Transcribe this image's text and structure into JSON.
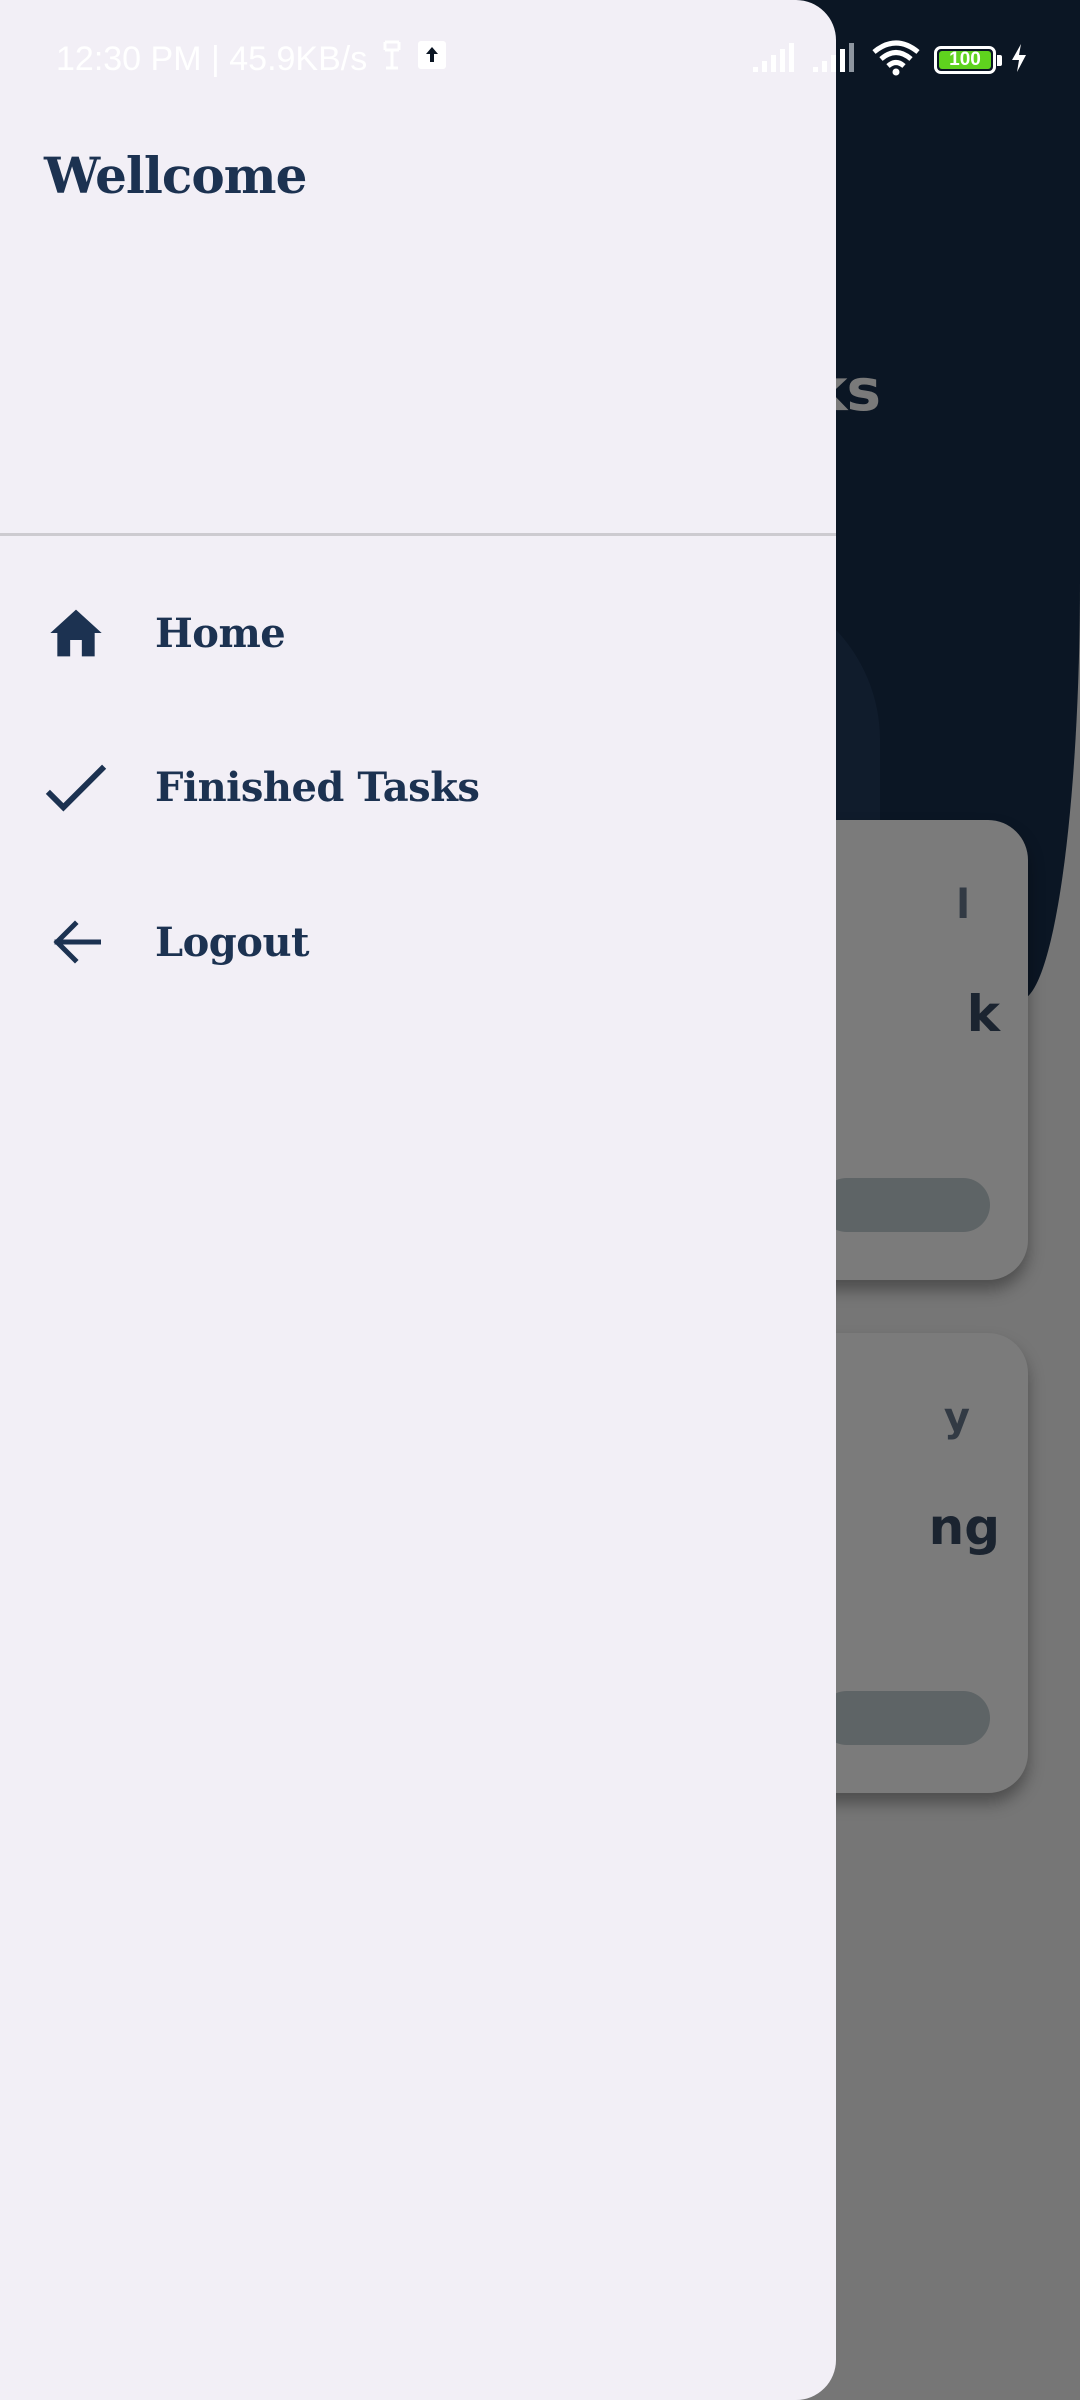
{
  "status_bar": {
    "time_speed": "12:30 PM | 45.9KB/s",
    "battery_level": "100",
    "battery_color": "#5fd21e",
    "icons": [
      "notification-icon",
      "upload-icon",
      "signal-icon",
      "signal-icon",
      "wifi-icon",
      "battery-icon",
      "charging-icon"
    ]
  },
  "drawer": {
    "header_title": "Wellcome",
    "items": [
      {
        "label": "Home",
        "icon": "home-icon"
      },
      {
        "label": "Finished Tasks",
        "icon": "check-icon"
      },
      {
        "label": "Logout",
        "icon": "arrow-left-icon"
      }
    ]
  },
  "background": {
    "title_fragment": "ks",
    "cards": [
      {
        "small": "l",
        "title": "k"
      },
      {
        "small": "y",
        "title": "ng"
      }
    ]
  },
  "colors": {
    "drawer_bg": "#f2eff6",
    "accent_text": "#1c3251",
    "header_bg": "#0b1624",
    "scrim": "#767676"
  }
}
